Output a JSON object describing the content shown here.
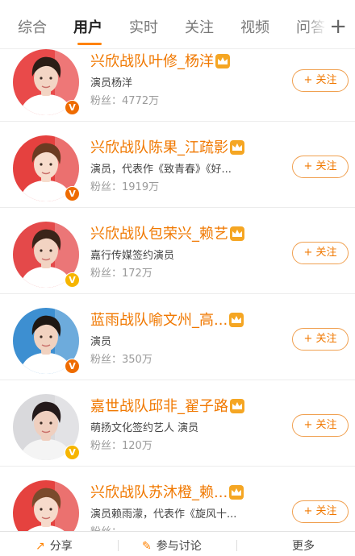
{
  "tabs": [
    {
      "label": "综合",
      "active": false
    },
    {
      "label": "用户",
      "active": true
    },
    {
      "label": "实时",
      "active": false
    },
    {
      "label": "关注",
      "active": false
    },
    {
      "label": "视频",
      "active": false
    },
    {
      "label": "问答",
      "active": false
    }
  ],
  "colors": {
    "accent": "#ff8200",
    "name": "#f07800",
    "verified_orange": "#ee6b00",
    "verified_gold": "#f6b500",
    "crown": "#f5a623"
  },
  "users": [
    {
      "name": "兴欣战队叶修_杨洋",
      "description": "演员杨洋",
      "fans": "粉丝：4772万",
      "follow_label": "+ 关注",
      "verified": "orange",
      "avatar_bg": "#e94a4a",
      "avatar_hair": "#2b1d16",
      "avatar_skin": "#f3d5c4",
      "avatar_cloth": "#ffffff"
    },
    {
      "name": "兴欣战队陈果_江疏影",
      "description": "演员，代表作《致青春》《好...",
      "fans": "粉丝：1919万",
      "follow_label": "+ 关注",
      "verified": "orange",
      "avatar_bg": "#e5413f",
      "avatar_hair": "#6b3b22",
      "avatar_skin": "#f7dccc",
      "avatar_cloth": "#ffffff"
    },
    {
      "name": "兴欣战队包荣兴_赖艺",
      "description": "嘉行传媒签约演员",
      "fans": "粉丝：172万",
      "follow_label": "+ 关注",
      "verified": "gold",
      "avatar_bg": "#e4494a",
      "avatar_hair": "#3a2419",
      "avatar_skin": "#f2d3c2",
      "avatar_cloth": "#ffffff"
    },
    {
      "name": "蓝雨战队喻文州_高...",
      "description": "演员",
      "fans": "粉丝：350万",
      "follow_label": "+ 关注",
      "verified": "orange",
      "avatar_bg": "#3d8fd1",
      "avatar_hair": "#1e1713",
      "avatar_skin": "#f1d2c0",
      "avatar_cloth": "#ffffff"
    },
    {
      "name": "嘉世战队邱非_翟子路",
      "description": "萌扬文化签约艺人 演员",
      "fans": "粉丝：120万",
      "follow_label": "+ 关注",
      "verified": "gold",
      "avatar_bg": "#d9d9dc",
      "avatar_hair": "#23191a",
      "avatar_skin": "#efcfbf",
      "avatar_cloth": "#f4f4f4"
    },
    {
      "name": "兴欣战队苏沐橙_赖...",
      "description": "演员赖雨濛，代表作《旋风十...",
      "fans": "粉丝：",
      "follow_label": "+ 关注",
      "verified": "orange",
      "avatar_bg": "#e5423f",
      "avatar_hair": "#7a4a2c",
      "avatar_skin": "#f6dacb",
      "avatar_cloth": "#ffffff"
    }
  ],
  "bottom_bar": {
    "share_label": "分享",
    "discuss_label": "参与讨论",
    "more_label": "更多"
  }
}
